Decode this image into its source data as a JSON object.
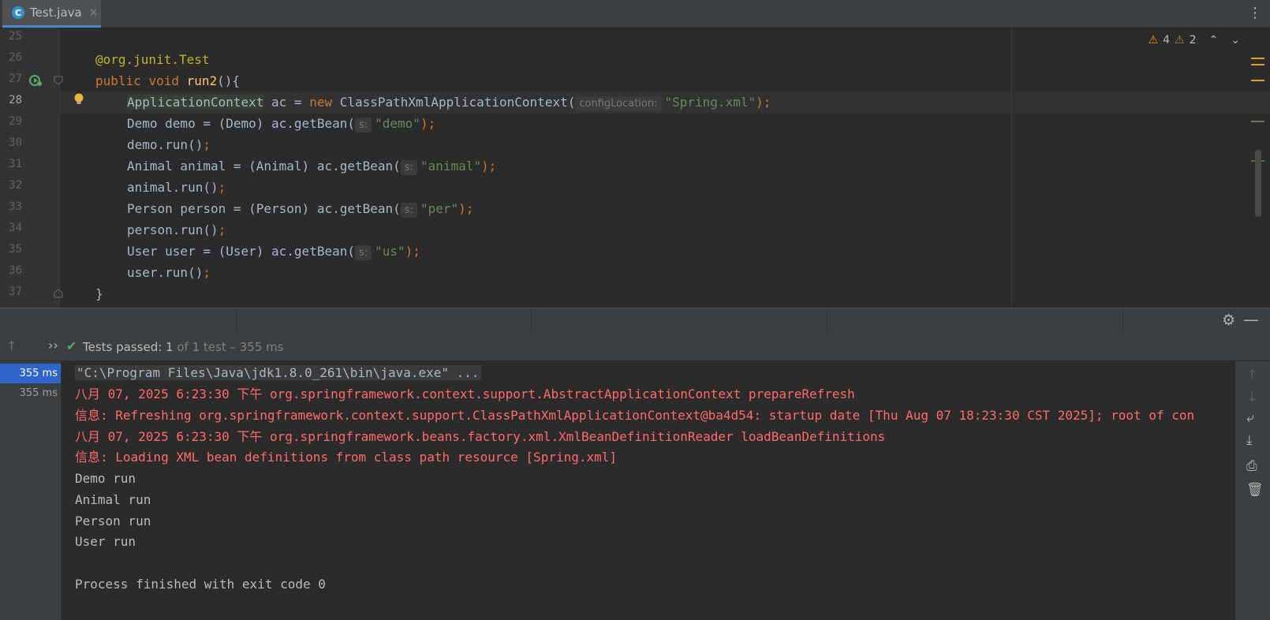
{
  "tab": {
    "icon": "C",
    "filename": "Test.java",
    "close": "×"
  },
  "editor": {
    "problems": {
      "warnings": "4",
      "weak_warnings": "2",
      "up": "⌃",
      "down": "⌄"
    },
    "line_numbers": [
      "25",
      "26",
      "27",
      "28",
      "29",
      "30",
      "31",
      "32",
      "33",
      "34",
      "35",
      "36",
      "37"
    ],
    "lines": {
      "l26_annotation": "@org.junit.",
      "l26_test": "Test",
      "l27_public": "public",
      "l27_void": "void",
      "l27_name": "run2",
      "l27_rest": "(){",
      "l28_type": "ApplicationContext",
      "l28_var": " ac = ",
      "l28_new": "new",
      "l28_ctor": " ClassPathXmlApplicationContext(",
      "l28_hint": "configLocation:",
      "l28_arg": "\"Spring.xml\"",
      "l28_end": ");",
      "l29_code": "Demo demo = (Demo) ac.getBean(",
      "l29_hint": "s:",
      "l29_arg": "\"demo\"",
      "l29_end": ");",
      "l30_code": "demo.run()",
      "l31_code": "Animal animal = (Animal) ac.getBean(",
      "l31_hint": "s:",
      "l31_arg": "\"animal\"",
      "l31_end": ");",
      "l32_code": "animal.run()",
      "l33_code": "Person person = (Person) ac.getBean(",
      "l33_hint": "s:",
      "l33_arg": "\"per\"",
      "l33_end": ");",
      "l34_code": "person.run()",
      "l35_code": "User user = (User) ac.getBean(",
      "l35_hint": "s:",
      "l35_arg": "\"us\"",
      "l35_end": ");",
      "l36_code": "user.run()",
      "l37_code": "}",
      "semicolon": ";"
    }
  },
  "run": {
    "status_prefix": "Tests passed: ",
    "status_count": "1",
    "status_suffix": " of 1 test – 355 ms",
    "tree": [
      "355 ms",
      "355 ms"
    ],
    "console": {
      "cmd": "\"C:\\Program Files\\Java\\jdk1.8.0_261\\bin\\java.exe\" ...",
      "line1": "八月 07, 2025 6:23:30 下午 org.springframework.context.support.AbstractApplicationContext prepareRefresh",
      "line2": "信息: Refreshing org.springframework.context.support.ClassPathXmlApplicationContext@ba4d54: startup date [Thu Aug 07 18:23:30 CST 2025]; root of con",
      "line3": "八月 07, 2025 6:23:30 下午 org.springframework.beans.factory.xml.XmlBeanDefinitionReader loadBeanDefinitions",
      "line4": "信息: Loading XML bean definitions from class path resource [Spring.xml]",
      "out1": "Demo run",
      "out2": "Animal run",
      "out3": "Person run",
      "out4": "User run",
      "exit": "Process finished with exit code 0"
    }
  },
  "colors": {
    "keyword": "#cc7832",
    "string": "#6a8759",
    "annotation": "#bbb529",
    "function": "#ffc66d",
    "error_text": "#ff6b68",
    "pass_green": "#59a869",
    "selection": "#2f65ca"
  }
}
